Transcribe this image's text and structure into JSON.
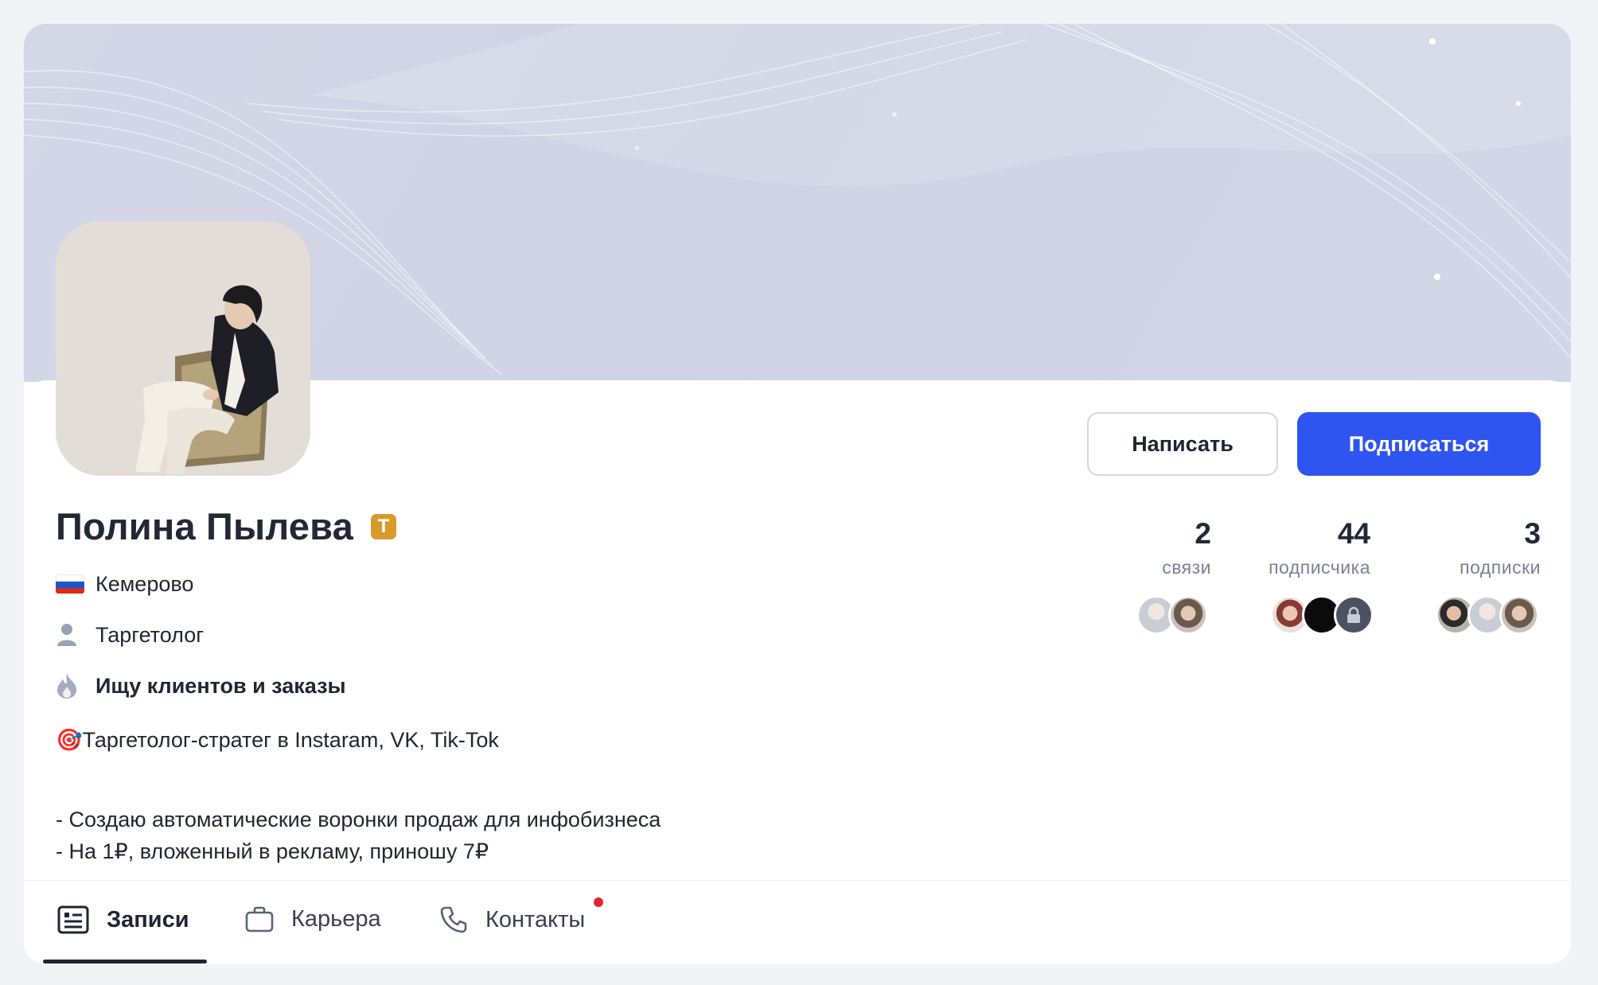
{
  "profile": {
    "name": "Полина Пылева",
    "badge_letter": "Т",
    "city": "Кемерово",
    "profession": "Таргетолог",
    "status": "Ищу клиентов и заказы",
    "bio_line1": "🎯Таргетолог-стратег в Instaram, VK, Tik-Tok",
    "bio_line2": "- Создаю автоматические воронки продаж для инфобизнеса",
    "bio_line3": "- На 1₽, вложенный в рекламу, приношу 7₽"
  },
  "actions": {
    "write_label": "Написать",
    "subscribe_label": "Подписаться"
  },
  "stats": [
    {
      "value": "2",
      "label": "связи"
    },
    {
      "value": "44",
      "label": "подписчика"
    },
    {
      "value": "3",
      "label": "подписки"
    }
  ],
  "tabs": [
    {
      "label": "Записи",
      "active": true
    },
    {
      "label": "Карьера",
      "active": false
    },
    {
      "label": "Контакты",
      "active": false,
      "has_notification": true
    }
  ],
  "colors": {
    "primary": "#2f55f0",
    "badge": "#d89a2b",
    "notification": "#e0262d",
    "cover": "#d1d5e5"
  },
  "icons": {
    "city": "russia-flag-icon",
    "profession": "person-icon",
    "status": "flame-icon",
    "tab_posts": "news-icon",
    "tab_career": "briefcase-icon",
    "tab_contacts": "phone-icon"
  }
}
